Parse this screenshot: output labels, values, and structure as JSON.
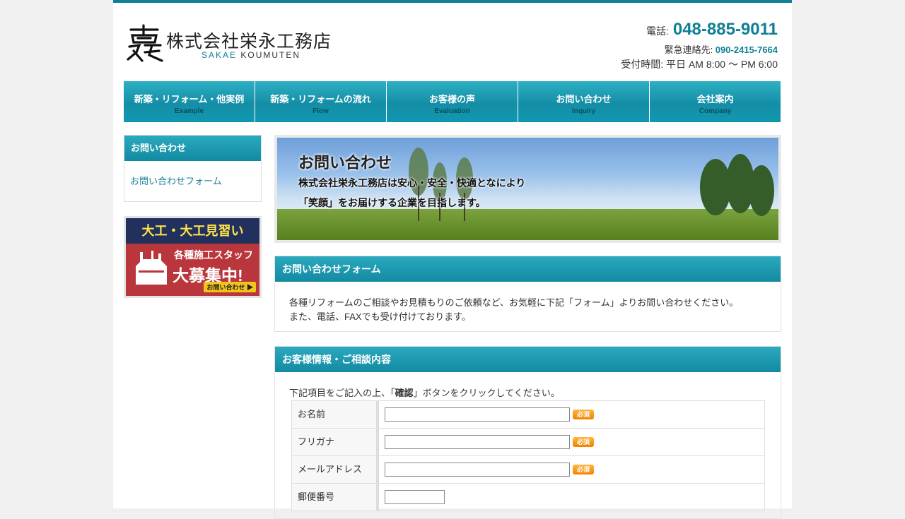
{
  "header": {
    "company_name": "株式会社栄永工務店",
    "company_sub_accent": "SAKAE",
    "company_sub_rest": " KOUMUTEN",
    "tel_label": "電話:",
    "tel_number": "048-885-9011",
    "emergency_label": "緊急連絡先: ",
    "emergency_number": "090-2415-7664",
    "hours": "受付時間: 平日 AM 8:00 ～ PM 6:00"
  },
  "nav": [
    {
      "jp": "新築・リフォーム・他実例",
      "en": "Example"
    },
    {
      "jp": "新築・リフォームの流れ",
      "en": "Flow"
    },
    {
      "jp": "お客様の声",
      "en": "Evaluation"
    },
    {
      "jp": "お問い合わせ",
      "en": "Inquiry"
    },
    {
      "jp": "会社案内",
      "en": "Company"
    }
  ],
  "sidebar": {
    "heading": "お問い合わせ",
    "link": "お問い合わせフォーム",
    "banner": {
      "title": "大工・大工見習い",
      "line1": "各種施工スタッフ",
      "line2": "大募集中!",
      "button": "お問い合わせ"
    }
  },
  "hero": {
    "title": "お問い合わせ",
    "line1": "株式会社栄永工務店は安心・安全・快適となにより",
    "line2": "「笑顔」をお届けする企業を目指します。"
  },
  "intro_section": {
    "heading": "お問い合わせフォーム",
    "line1": "各種リフォームのご相談やお見積もりのご依頼など、お気軽に下記「フォーム」よりお問い合わせください。",
    "line2": "また、電話、FAXでも受け付けております。"
  },
  "form_section": {
    "heading": "お客様情報・ご相談内容",
    "instr_before": "下記項目をご記入の上、「",
    "instr_bold": "確認",
    "instr_after": "」ボタンをクリックしてください。",
    "required_label": "必須",
    "fields": [
      {
        "label": "お名前",
        "value": ""
      },
      {
        "label": "フリガナ",
        "value": ""
      },
      {
        "label": "メールアドレス",
        "value": ""
      },
      {
        "label": "郵便番号",
        "value": ""
      }
    ]
  }
}
